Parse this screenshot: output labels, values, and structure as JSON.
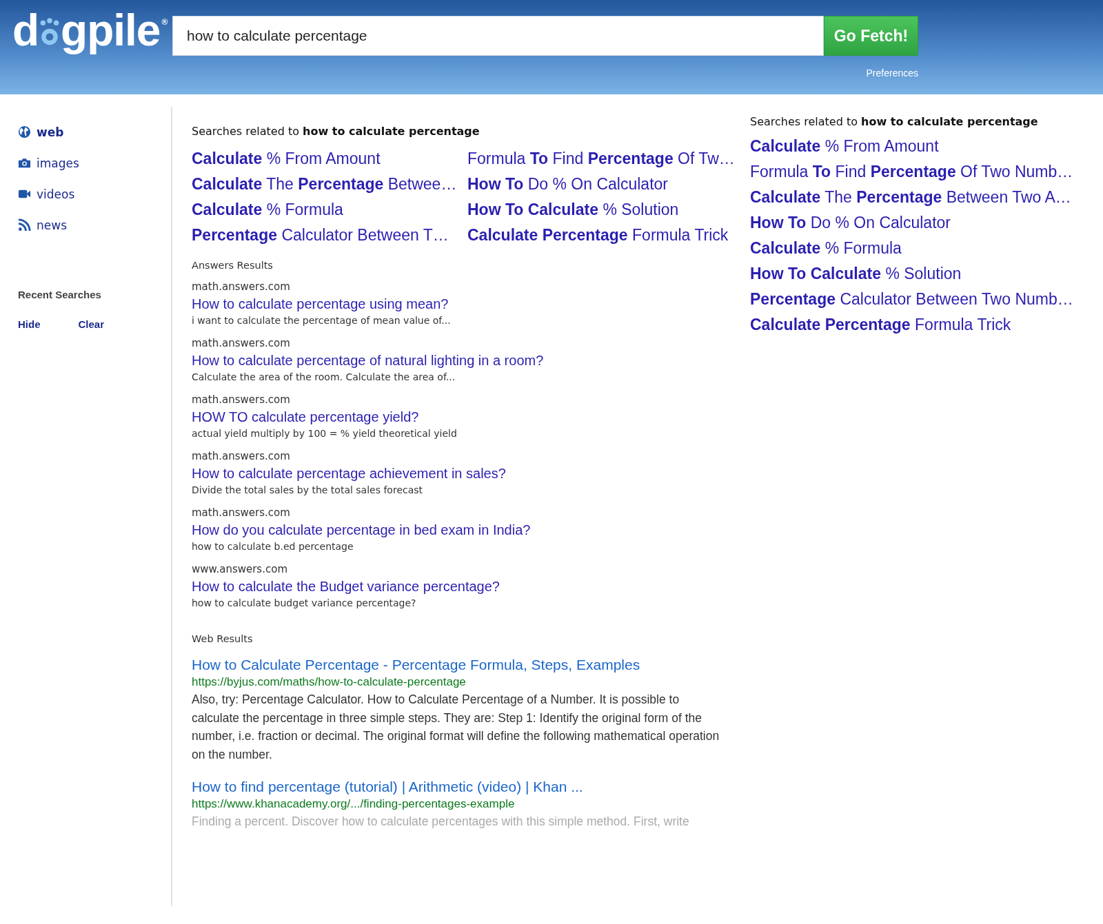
{
  "header": {
    "logo": {
      "before": "d",
      "after": "gpile",
      "mark": "®"
    },
    "search": {
      "value": "how to calculate percentage"
    },
    "button": "Go Fetch!",
    "preferences": "Preferences"
  },
  "sidebar": {
    "items": [
      {
        "kind": "globe",
        "label": "web",
        "selected": true
      },
      {
        "kind": "camera",
        "label": "images",
        "selected": false
      },
      {
        "kind": "video",
        "label": "videos",
        "selected": false
      },
      {
        "kind": "rss",
        "label": "news",
        "selected": false
      }
    ],
    "recent": {
      "title": "Recent Searches",
      "actions": [
        "Hide",
        "Clear"
      ]
    }
  },
  "related": {
    "heading": "Searches related to **how to calculate percentage**",
    "links": [
      "**Calculate** % From Amount",
      "Formula **To** Find **Percentage** Of Tw…",
      "**Calculate** The **Percentage** Betwee…",
      "**How To** Do % On Calculator",
      "**Calculate** % Formula",
      "**How To Calculate** % Solution",
      "**Percentage** Calculator Between T…",
      "**Calculate Percentage** Formula Trick"
    ]
  },
  "answers": {
    "heading": "Answers Results",
    "items": [
      {
        "domain": "math.answers.com",
        "title": "How to calculate percentage using mean?",
        "snippet": "i want to calculate the percentage of mean value of..."
      },
      {
        "domain": "math.answers.com",
        "title": "How to calculate percentage of natural lighting in a room?",
        "snippet": "Calculate the area of the room. Calculate the area of..."
      },
      {
        "domain": "math.answers.com",
        "title": "HOW TO calculate percentage yield?",
        "snippet": "actual yield multiply by 100 = % yield theoretical yield"
      },
      {
        "domain": "math.answers.com",
        "title": "How to calculate percentage achievement in sales?",
        "snippet": "Divide the total sales by the total sales forecast"
      },
      {
        "domain": "math.answers.com",
        "title": "How do you calculate percentage in bed exam in India?",
        "snippet": "how to calculate b.ed percentage"
      },
      {
        "domain": "www.answers.com",
        "title": "How to calculate the Budget variance percentage?",
        "snippet": "how to calculate budget variance percentage?"
      }
    ]
  },
  "web": {
    "heading": "Web Results",
    "items": [
      {
        "title": "How to Calculate Percentage - Percentage Formula, Steps, Examples",
        "url": "https://byjus.com/maths/how-to-calculate-percentage",
        "snippet": "Also, try: Percentage Calculator. How to Calculate Percentage of a Number. It is possible to calculate the percentage in three simple steps. They are: Step 1: Identify the original form of the number, i.e. fraction or decimal. The original format will define the following mathematical operation on the number.",
        "faded": false
      },
      {
        "title": "How to find percentage (tutorial) | Arithmetic (video) | Khan ...",
        "url": "https://www.khanacademy.org/.../finding-percentages-example",
        "snippet": "Finding a percent. Discover how to calculate percentages with this simple method. First, write",
        "faded": true
      }
    ]
  },
  "aside": {
    "heading": "Searches related to **how to calculate percentage**",
    "links": [
      "**Calculate** % From Amount",
      "Formula **To** Find **Percentage** Of Two Numb…",
      "**Calculate** The **Percentage** Between Two A…",
      "**How To** Do % On Calculator",
      "**Calculate** % Formula",
      "**How To Calculate** % Solution",
      "**Percentage** Calculator Between Two Numb…",
      "**Calculate Percentage** Formula Trick"
    ]
  }
}
